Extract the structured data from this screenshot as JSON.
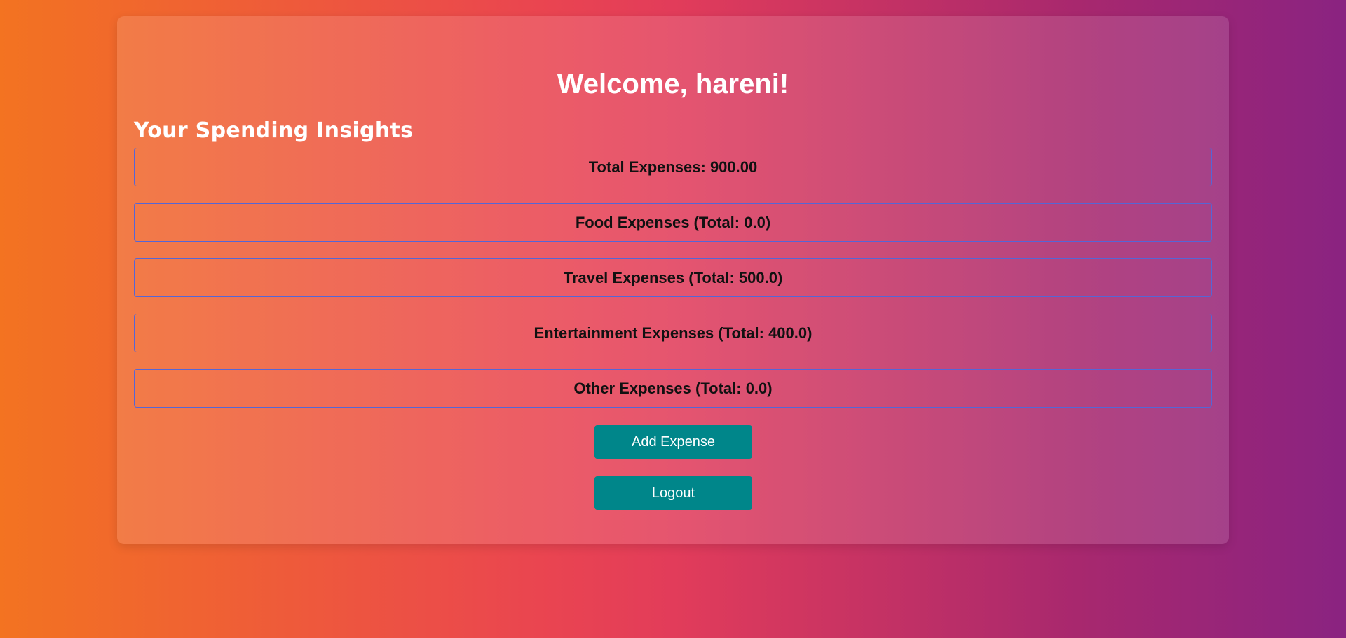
{
  "header": {
    "welcome_text": "Welcome, hareni!"
  },
  "insights": {
    "title": "Your Spending Insights",
    "items": [
      {
        "label": "Total Expenses: 900.00"
      },
      {
        "label": "Food Expenses (Total: 0.0)"
      },
      {
        "label": "Travel Expenses (Total: 500.0)"
      },
      {
        "label": "Entertainment Expenses (Total: 400.0)"
      },
      {
        "label": "Other Expenses (Total: 0.0)"
      }
    ]
  },
  "actions": {
    "add_expense_label": "Add Expense",
    "logout_label": "Logout"
  },
  "colors": {
    "button_bg": "#00868a",
    "item_border": "#5566d6",
    "gradient_start": "#f37321",
    "gradient_end": "#8a2381"
  }
}
